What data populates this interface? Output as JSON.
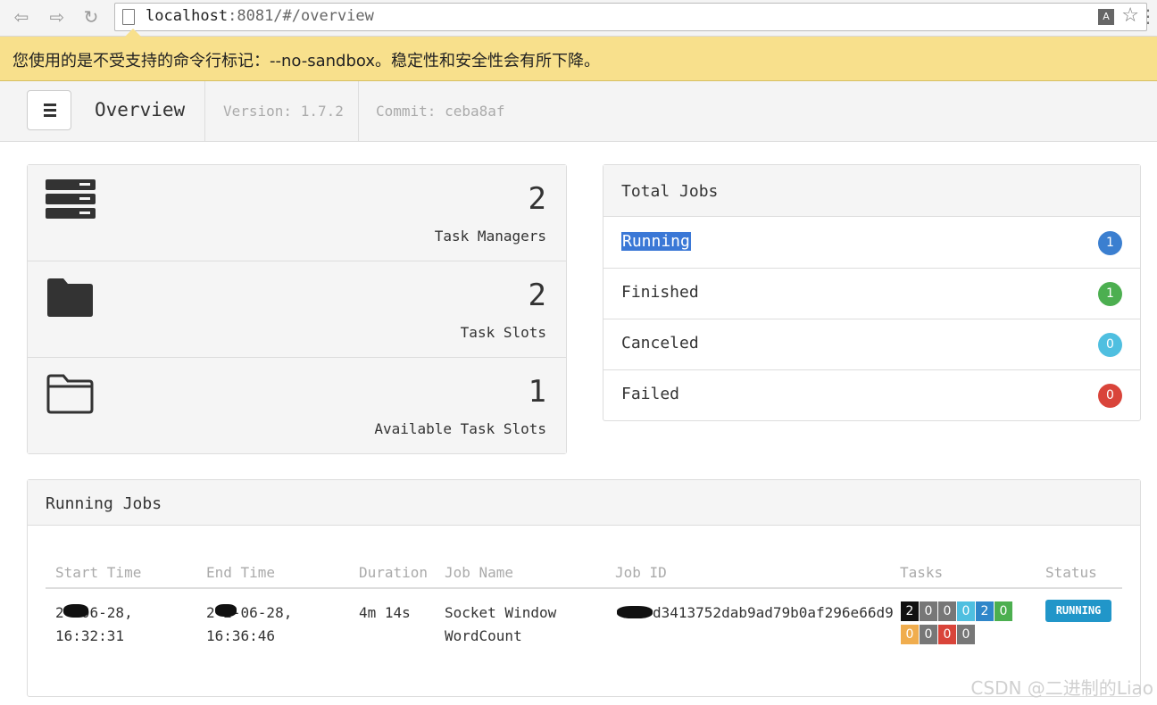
{
  "browser": {
    "url_host": "localhost",
    "url_rest": ":8081/#/overview",
    "translate_glyph": "A",
    "infobar_text": "您使用的是不受支持的命令行标记：--no-sandbox。稳定性和安全性会有所下降。"
  },
  "header": {
    "title": "Overview",
    "version": "Version: 1.7.2",
    "commit": "Commit: ceba8af"
  },
  "stats": [
    {
      "value": "2",
      "label": "Task Managers",
      "icon": "server-icon"
    },
    {
      "value": "2",
      "label": "Task Slots",
      "icon": "folder-filled-icon"
    },
    {
      "value": "1",
      "label": "Available Task Slots",
      "icon": "folder-open-icon"
    }
  ],
  "total_jobs": {
    "title": "Total Jobs",
    "rows": [
      {
        "label": "Running",
        "count": "1",
        "color": "#3b7fd0"
      },
      {
        "label": "Finished",
        "count": "1",
        "color": "#4caf50"
      },
      {
        "label": "Canceled",
        "count": "0",
        "color": "#4fbfe0"
      },
      {
        "label": "Failed",
        "count": "0",
        "color": "#d9443a"
      }
    ]
  },
  "running_jobs": {
    "title": "Running Jobs",
    "columns": [
      "Start Time",
      "End Time",
      "Duration",
      "Job Name",
      "Job ID",
      "Tasks",
      "Status"
    ],
    "rows": [
      {
        "start_time_1": "2   -06-28,",
        "start_time_2": "16:32:31",
        "end_time_1": "2   2-06-28,",
        "end_time_2": "16:36:46",
        "duration": "4m 14s",
        "job_name_1": "Socket Window",
        "job_name_2": "WordCount",
        "job_id": "d3413752dab9ad79b0af296e66d9",
        "tasks_row1": [
          "2",
          "0",
          "0",
          "0",
          "2",
          "0"
        ],
        "tasks_row2": [
          "0",
          "0",
          "0",
          "0"
        ],
        "status": "RUNNING"
      }
    ]
  },
  "task_colors": {
    "row1": [
      "#111111",
      "#777777",
      "#777777",
      "#4fbfe0",
      "#2f86c9",
      "#4caf50"
    ],
    "row2": [
      "#f0ad4e",
      "#777777",
      "#d9443a",
      "#777777"
    ]
  },
  "watermark": "CSDN @二进制的Liao"
}
